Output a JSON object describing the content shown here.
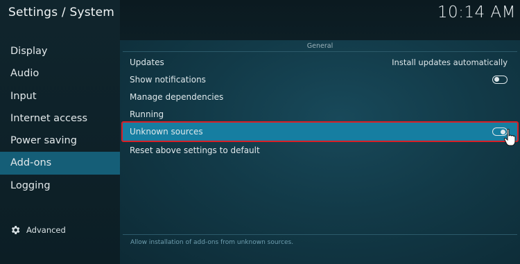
{
  "header": {
    "title": "Settings / System",
    "clock": "10:14 AM"
  },
  "sidebar": {
    "items": [
      {
        "label": "Display"
      },
      {
        "label": "Audio"
      },
      {
        "label": "Input"
      },
      {
        "label": "Internet access"
      },
      {
        "label": "Power saving"
      },
      {
        "label": "Add-ons",
        "selected": true
      },
      {
        "label": "Logging"
      }
    ],
    "advanced": {
      "label": "Advanced",
      "icon": "gear-icon"
    }
  },
  "panel": {
    "section": "General",
    "settings": [
      {
        "label": "Updates",
        "value": "Install updates automatically"
      },
      {
        "label": "Show notifications",
        "toggle": "off"
      },
      {
        "label": "Manage dependencies"
      },
      {
        "label": "Running"
      },
      {
        "label": "Unknown sources",
        "toggle": "on",
        "highlighted": true
      },
      {
        "label": "Reset above settings to default"
      }
    ],
    "hint": "Allow installation of add-ons from unknown sources."
  },
  "colors": {
    "selected": "#155e77",
    "highlight": "#167ea1",
    "highlight_border": "#d91f26"
  }
}
